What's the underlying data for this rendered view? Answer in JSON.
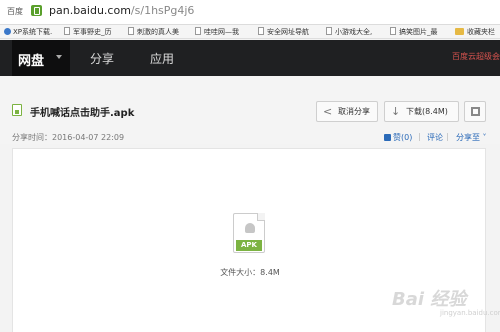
{
  "browser": {
    "site_label": "百度",
    "url_host": "pan.baidu.com",
    "url_path": "/s/1hsPg4j6"
  },
  "bookmarks": [
    {
      "label": "XP系统下载."
    },
    {
      "label": "军事野史_历"
    },
    {
      "label": "刺激的真人美"
    },
    {
      "label": "哇哇网—我"
    },
    {
      "label": "安全网址导航"
    },
    {
      "label": "小游戏大全,"
    },
    {
      "label": "搞笑图片_最"
    },
    {
      "label": "收藏夹栏"
    }
  ],
  "nav": {
    "brand": "网盘",
    "tabs": [
      "分享",
      "应用"
    ],
    "right_text": "百度云超级会"
  },
  "file": {
    "name": "手机喊话点击助手.apk",
    "share_time": "分享时间：2016-04-07 22:09",
    "cancel_share": "取消分享",
    "download": "下载(8.4M)",
    "like": "赞(0)",
    "comment": "评论",
    "share_to": "分享至",
    "icon_tag": "APK",
    "size_text": "文件大小：8.4M"
  },
  "watermark": {
    "text": "Bai 经验",
    "sub": "jingyan.baidu.com"
  },
  "colors": {
    "nav_bg": "#1f2022",
    "accent_green": "#7cb342",
    "link_blue": "#2b6ab8"
  }
}
